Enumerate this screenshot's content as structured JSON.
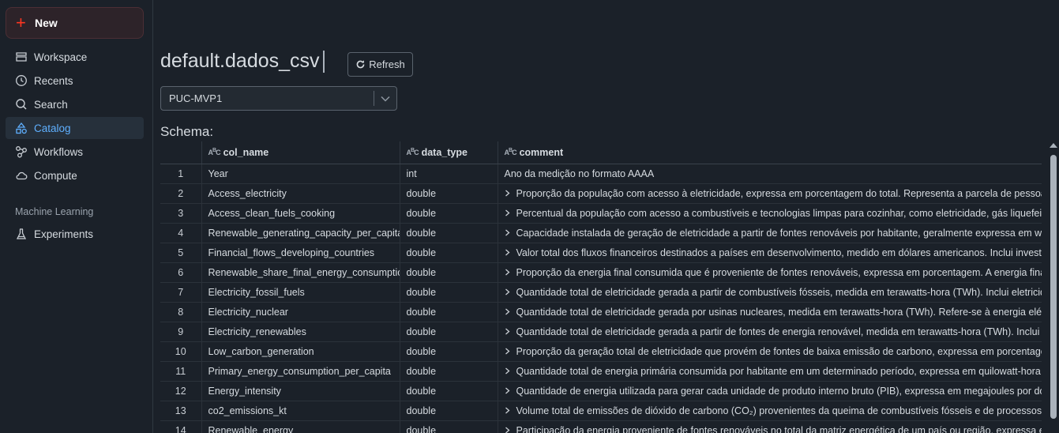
{
  "sidebar": {
    "new_label": "New",
    "items": [
      {
        "label": "Workspace",
        "icon": "workspace-icon"
      },
      {
        "label": "Recents",
        "icon": "clock-icon"
      },
      {
        "label": "Search",
        "icon": "search-icon"
      },
      {
        "label": "Catalog",
        "icon": "catalog-icon",
        "active": true
      },
      {
        "label": "Workflows",
        "icon": "workflows-icon"
      },
      {
        "label": "Compute",
        "icon": "cloud-icon"
      }
    ],
    "section_ml": "Machine Learning",
    "ml_items": [
      {
        "label": "Experiments",
        "icon": "flask-icon"
      }
    ]
  },
  "header": {
    "title": "default.dados_csv",
    "refresh_label": "Refresh"
  },
  "warehouse_select": {
    "value": "PUC-MVP1"
  },
  "schema_label": "Schema:",
  "table": {
    "columns": [
      "col_name",
      "data_type",
      "comment"
    ],
    "rows": [
      {
        "n": "1",
        "col_name": "Year",
        "data_type": "int",
        "comment": "Ano da medição no formato AAAA",
        "expandable": false
      },
      {
        "n": "2",
        "col_name": "Access_electricity",
        "data_type": "double",
        "comment": "Proporção da população com acesso à eletricidade, expressa em porcentagem do total. Representa a parcela de pessoas em u",
        "expandable": true
      },
      {
        "n": "3",
        "col_name": "Access_clean_fuels_cooking",
        "data_type": "double",
        "comment": "Percentual da população com acesso a combustíveis e tecnologias limpas para cozinhar, como eletricidade, gás liquefeito de p",
        "expandable": true
      },
      {
        "n": "4",
        "col_name": "Renewable_generating_capacity_per_capita",
        "data_type": "double",
        "comment": "Capacidade instalada de geração de eletricidade a partir de fontes renováveis por habitante, geralmente expressa em watts po",
        "expandable": true
      },
      {
        "n": "5",
        "col_name": "Financial_flows_developing_countries",
        "data_type": "double",
        "comment": "Valor total dos fluxos financeiros destinados a países em desenvolvimento, medido em dólares americanos. Inclui investimento",
        "expandable": true
      },
      {
        "n": "6",
        "col_name": "Renewable_share_final_energy_consumption",
        "data_type": "double",
        "comment": "Proporção da energia final consumida que é proveniente de fontes renováveis, expressa em porcentagem. A energia final inclu",
        "expandable": true
      },
      {
        "n": "7",
        "col_name": "Electricity_fossil_fuels",
        "data_type": "double",
        "comment": "Quantidade total de eletricidade gerada a partir de combustíveis fósseis, medida em terawatts-hora (TWh). Inclui eletricidade p",
        "expandable": true
      },
      {
        "n": "8",
        "col_name": "Electricity_nuclear",
        "data_type": "double",
        "comment": "Quantidade total de eletricidade gerada por usinas nucleares, medida em terawatts-hora (TWh). Refere-se à energia elétrica pr",
        "expandable": true
      },
      {
        "n": "9",
        "col_name": "Electricity_renewables",
        "data_type": "double",
        "comment": "Quantidade total de eletricidade gerada a partir de fontes de energia renovável, medida em terawatts-hora (TWh). Inclui eletri",
        "expandable": true
      },
      {
        "n": "10",
        "col_name": "Low_carbon_generation",
        "data_type": "double",
        "comment": "Proporção da geração total de eletricidade que provém de fontes de baixa emissão de carbono, expressa em porcentagem. In",
        "expandable": true
      },
      {
        "n": "11",
        "col_name": "Primary_energy_consumption_per_capita",
        "data_type": "double",
        "comment": "Quantidade total de energia primária consumida por habitante em um determinado período, expressa em quilowatt-hora (kW",
        "expandable": true
      },
      {
        "n": "12",
        "col_name": "Energy_intensity",
        "data_type": "double",
        "comment": "Quantidade de energia utilizada para gerar cada unidade de produto interno bruto (PIB), expressa em megajoules por dólar (M",
        "expandable": true
      },
      {
        "n": "13",
        "col_name": "co2_emissions_kt",
        "data_type": "double",
        "comment": "Volume total de emissões de dióxido de carbono (CO₂) provenientes da queima de combustíveis fósseis e de processos indust",
        "expandable": true
      },
      {
        "n": "14",
        "col_name": "Renewable_energy",
        "data_type": "double",
        "comment": "Participação da energia proveniente de fontes renováveis no total da matriz energética de um país ou região, expressa em por",
        "expandable": true
      }
    ]
  },
  "colors": {
    "accent": "#5fb0ff",
    "new_plus": "#ff3621",
    "background": "#1b2129"
  }
}
